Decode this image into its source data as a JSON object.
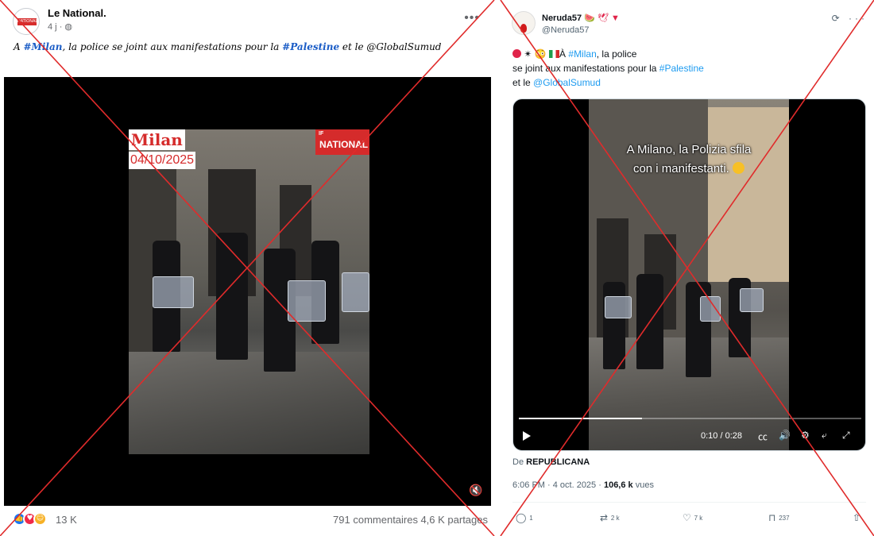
{
  "facebook_post": {
    "page_name": "Le National.",
    "timestamp": "4 j",
    "avatar_text": "NATIONAL",
    "caption_prefix": "A ",
    "caption_tag1": "#Milan",
    "caption_mid": ", la police se joint aux manifestations pour la ",
    "caption_tag2": "#Palestine",
    "caption_suffix": " et le @GlobalSumud",
    "video_overlay_city": "Milan",
    "video_overlay_date": "04/10/2025",
    "video_logo_small": "IF",
    "video_logo": "NATIONAL",
    "reaction_count": "13 K",
    "comments": "791 commentaires",
    "shares": "4,6 K partages"
  },
  "x_post": {
    "display_name": "Neruda57",
    "handle": "@Neruda57",
    "text_prefix": "À ",
    "text_tag1": "#Milan",
    "text_mid1": ", la police",
    "text_line2": "se joint aux manifestations pour la ",
    "text_tag2": "#Palestine",
    "text_line3": "et le ",
    "text_tag3": "@GlobalSumud",
    "video_overlay_line1": "A Milano, la Polizia sfila",
    "video_overlay_line2": "con i manifestanti.",
    "video_time": "0:10 / 0:28",
    "video_progress": 0.36,
    "source_prefix": "De",
    "source_name": "REPUBLICANA",
    "timestamp": "6:06 PM · 4 oct. 2025 · ",
    "views_count": "106,6 k",
    "views_label": " vues",
    "replies": "1",
    "reposts": "2 k",
    "likes": "7 k",
    "bookmarks": "237"
  },
  "colors": {
    "cross": "#e02b2b",
    "fb_link": "#1a5cc6",
    "x_link": "#1d9bf0"
  }
}
